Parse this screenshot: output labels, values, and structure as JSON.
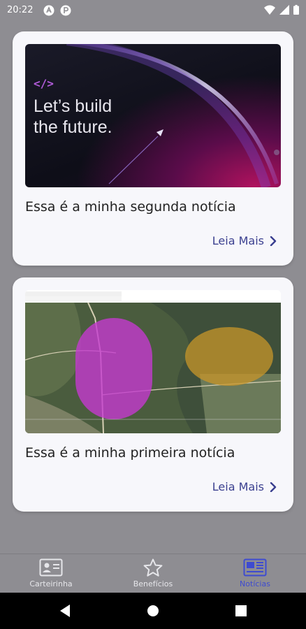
{
  "status_bar": {
    "time": "20:22",
    "app_icons": [
      "a-icon",
      "p-icon"
    ],
    "right_icons": [
      "wifi-icon",
      "signal-icon",
      "battery-icon"
    ]
  },
  "news": [
    {
      "image_text_lines": [
        "Let’s build",
        "the future."
      ],
      "image_code_symbol": "</>",
      "title": "Essa é a minha segunda notícia",
      "read_more": "Leia Mais"
    },
    {
      "image_type": "satellite map",
      "title": "Essa é a minha primeira notícia",
      "read_more": "Leia Mais"
    }
  ],
  "bottom_nav": {
    "items": [
      {
        "label": "Carteirinha",
        "icon": "id-card-icon",
        "active": false
      },
      {
        "label": "Benefícios",
        "icon": "star-icon",
        "active": false
      },
      {
        "label": "Notícias",
        "icon": "newspaper-icon",
        "active": true
      }
    ]
  },
  "system_nav": [
    "back-icon",
    "home-icon",
    "recents-icon"
  ],
  "colors": {
    "background": "#8e8d92",
    "card": "#f7f7fb",
    "accent": "#3a3f8f",
    "active_nav": "#3e4bd0"
  }
}
